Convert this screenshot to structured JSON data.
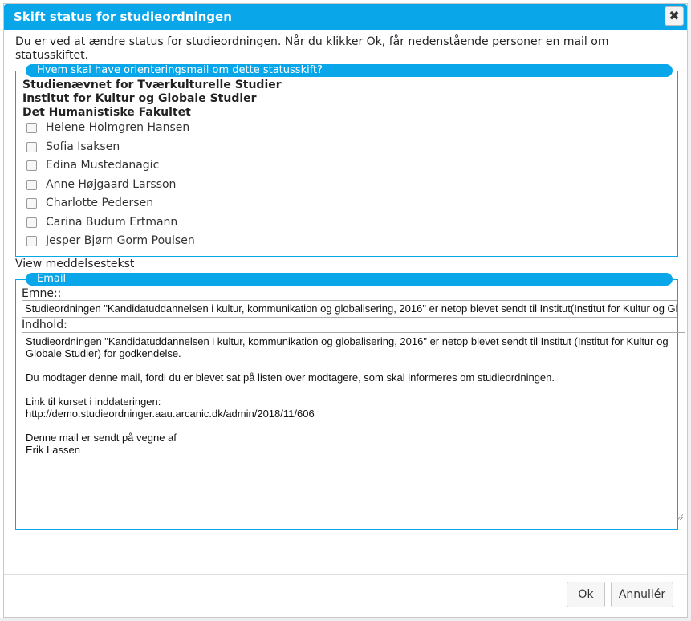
{
  "dialog": {
    "title": "Skift status for studieordningen",
    "close_label": "✖",
    "intro": "Du er ved at ændre status for studieordningen. Når du klikker Ok, får nedenstående personer en mail om statusskiftet."
  },
  "recipients": {
    "legend": "Hvem skal have orienteringsmail om dette statusskift?",
    "organizations": [
      "Studienævnet for Tværkulturelle Studier",
      "Institut for Kultur og Globale Studier",
      "Det Humanistiske Fakultet"
    ],
    "people": [
      {
        "name": "Helene Holmgren Hansen",
        "checked": false
      },
      {
        "name": "Sofia Isaksen",
        "checked": false
      },
      {
        "name": "Edina Mustedanagic",
        "checked": false
      },
      {
        "name": "Anne Højgaard Larsson",
        "checked": false
      },
      {
        "name": "Charlotte Pedersen",
        "checked": false
      },
      {
        "name": "Carina Budum Ertmann",
        "checked": false
      },
      {
        "name": "Jesper Bjørn Gorm Poulsen",
        "checked": false
      }
    ]
  },
  "view_message_link": "View meddelsestekst",
  "email": {
    "legend": "Email",
    "subject_label": "Emne::",
    "subject_value": "Studieordningen \"Kandidatuddannelsen i kultur, kommunikation og globalisering, 2016\" er netop blevet sendt til Institut(Institut for Kultur og Globale Studier) for godkendelse",
    "body_label": "Indhold:",
    "body_paragraphs": [
      "Studieordningen \"Kandidatuddannelsen i kultur, kommunikation og globalisering, 2016\" er netop blevet sendt til Institut (Institut for Kultur og Globale Studier) for godkendelse.",
      "Du modtager denne mail, fordi du er blevet sat på listen over modtagere, som skal informeres om studieordningen.",
      "Link til kurset i inddateringen:\nhttp://demo.studieordninger.aau.arcanic.dk/admin/2018/11/606",
      "Denne mail er sendt på vegne af\nErik Lassen"
    ]
  },
  "buttons": {
    "ok": "Ok",
    "cancel": "Annullér"
  },
  "colors": {
    "accent": "#0aa6ea"
  }
}
